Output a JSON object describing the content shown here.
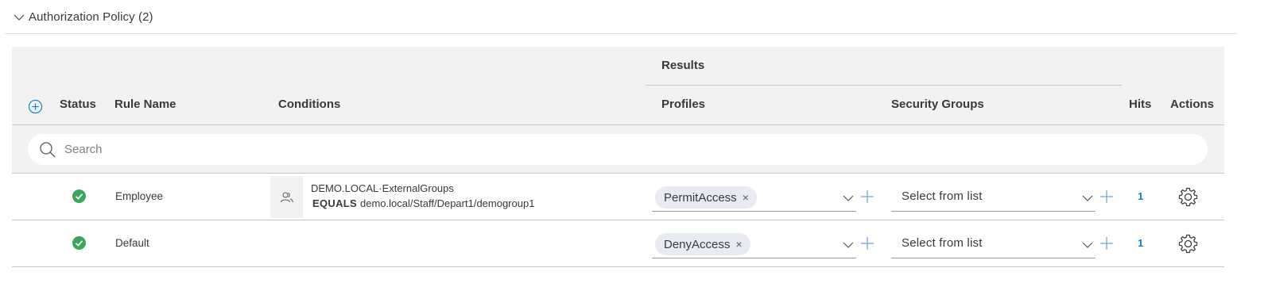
{
  "section": {
    "title": "Authorization Policy (2)"
  },
  "header": {
    "results": "Results",
    "status": "Status",
    "rule_name": "Rule Name",
    "conditions": "Conditions",
    "profiles": "Profiles",
    "security_groups": "Security Groups",
    "hits": "Hits",
    "actions": "Actions"
  },
  "search": {
    "placeholder": "Search"
  },
  "rows": [
    {
      "status": "enabled",
      "name": "Employee",
      "condition": {
        "attribute": "DEMO.LOCAL·ExternalGroups",
        "operator": "EQUALS",
        "value": "demo.local/Staff/Depart1/demogroup1"
      },
      "profile": "PermitAccess",
      "security_group": "Select from list",
      "hits": "1"
    },
    {
      "status": "enabled",
      "name": "Default",
      "condition": null,
      "profile": "DenyAccess",
      "security_group": "Select from list",
      "hits": "1"
    }
  ],
  "colors": {
    "accent": "#0d7ec8",
    "status_ok": "#3ba55c",
    "header_bg": "#f2f2f2",
    "chip_bg": "#e8ebf1"
  },
  "icons": {
    "collapse": "chevron-down-icon",
    "add_rule": "plus-circle-icon",
    "search": "search-icon",
    "status": "check-circle-icon",
    "condition": "user-group-icon",
    "dropdown": "chevron-down-icon",
    "add": "plus-icon",
    "actions": "gear-icon"
  }
}
